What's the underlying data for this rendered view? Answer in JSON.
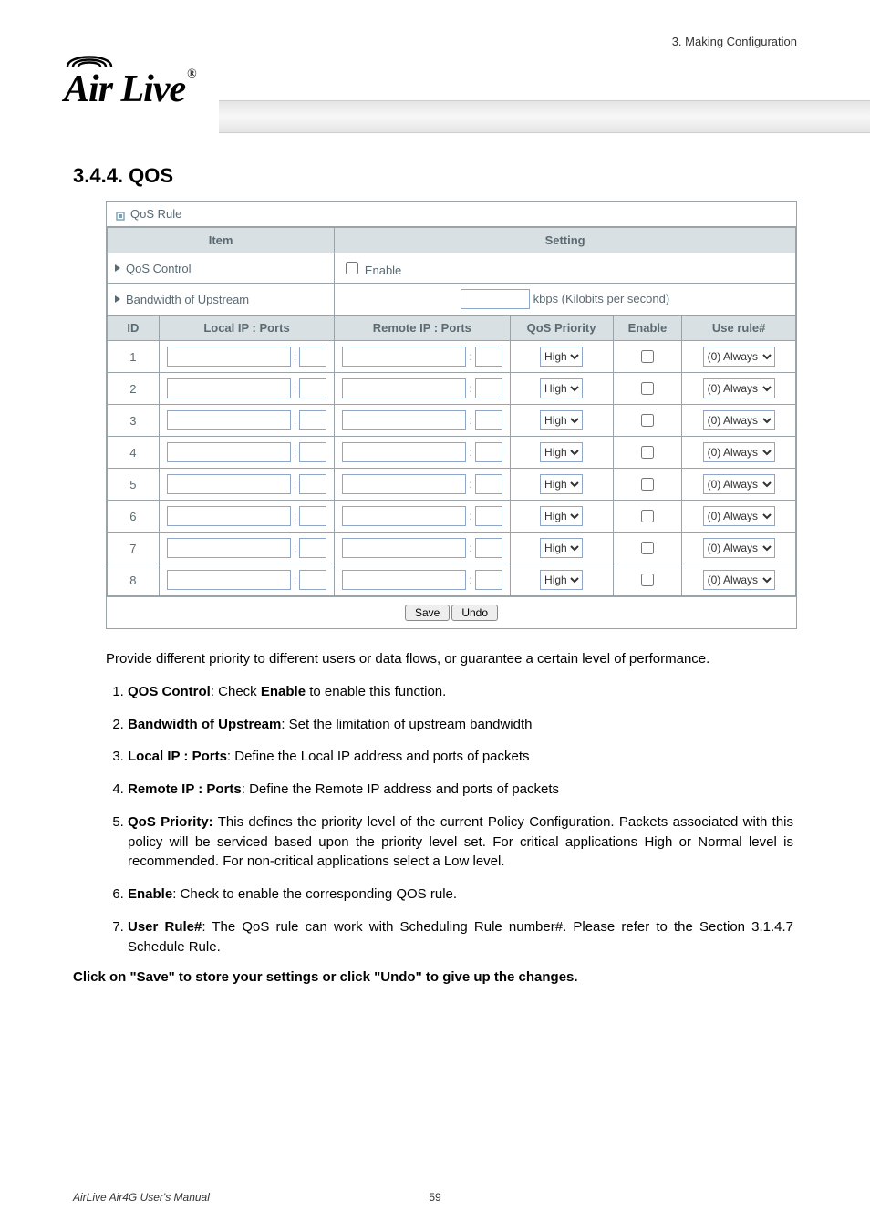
{
  "header": {
    "chapter": "3. Making Configuration",
    "logo_text": "Air Live",
    "logo_reg": "®"
  },
  "section_heading": "3.4.4.  QOS",
  "qos": {
    "panel_title": "QoS Rule",
    "item_header": "Item",
    "setting_header": "Setting",
    "control_label": "QoS Control",
    "enable_label": "Enable",
    "bandwidth_label": "Bandwidth of Upstream",
    "bandwidth_unit": "kbps (Kilobits per second)",
    "cols": {
      "id": "ID",
      "local": "Local IP : Ports",
      "remote": "Remote IP : Ports",
      "priority": "QoS Priority",
      "enable": "Enable",
      "userule": "Use rule#"
    },
    "priority_option": "High",
    "userule_option": "(0) Always",
    "rows": [
      1,
      2,
      3,
      4,
      5,
      6,
      7,
      8
    ],
    "save_btn": "Save",
    "undo_btn": "Undo"
  },
  "intro": "Provide different priority to different users or data flows, or guarantee a certain level of performance.",
  "list": [
    {
      "lead": "QOS Control",
      "text": ": Check Enable to enable this function.",
      "bold_extra": "Enable"
    },
    {
      "lead": "Bandwidth of Upstream",
      "text": ": Set the limitation of upstream bandwidth"
    },
    {
      "lead": "Local IP : Ports",
      "text": ": Define the Local IP address and ports of packets"
    },
    {
      "lead": "Remote IP : Ports",
      "text": ": Define the Remote IP address and ports of packets"
    },
    {
      "lead": "QoS Priority:",
      "text": " This defines the priority level of the current Policy Configuration. Packets associated with this policy will be serviced based upon the priority level set. For critical applications High or Normal level is recommended. For non-critical applications select a Low level."
    },
    {
      "lead": "Enable",
      "text": ": Check to enable the corresponding QOS rule."
    },
    {
      "lead": "User Rule#",
      "text": ": The QoS rule can work with Scheduling Rule number#. Please refer to the Section 3.1.4.7 Schedule Rule."
    }
  ],
  "final": "Click on \"Save\" to store your settings or click \"Undo\" to give up the changes.",
  "footer": {
    "left": "AirLive Air4G User's Manual",
    "page": "59"
  }
}
